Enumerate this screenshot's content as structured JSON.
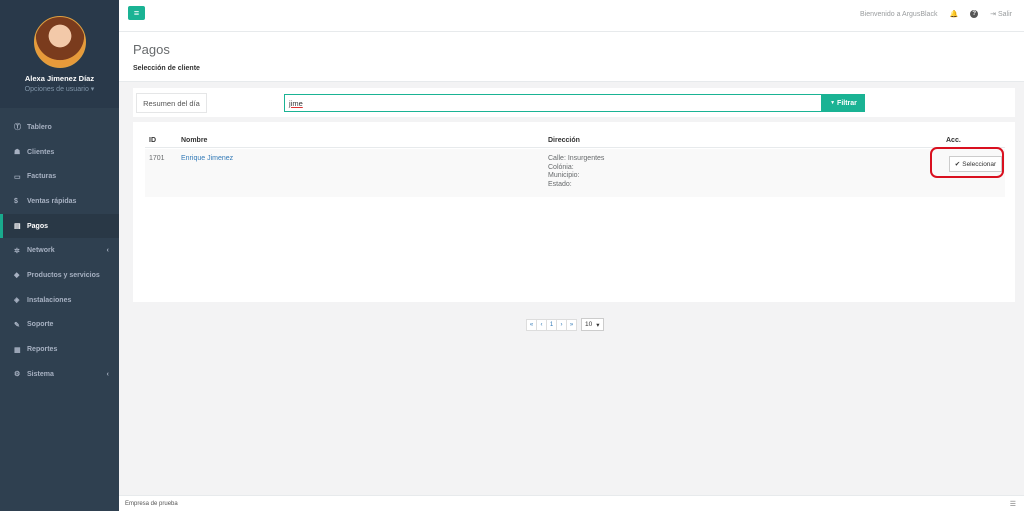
{
  "user": {
    "name": "Alexa Jimenez Díaz",
    "options": "Opciones de usuario ▾"
  },
  "nav": [
    {
      "icon": "Ⓣ",
      "label": "Tablero",
      "icon_name": "dashboard-icon"
    },
    {
      "icon": "☗",
      "label": "Clientes",
      "icon_name": "users-icon"
    },
    {
      "icon": "▭",
      "label": "Facturas",
      "icon_name": "file-icon"
    },
    {
      "icon": "$",
      "label": "Ventas rápidas",
      "icon_name": "dollar-icon"
    },
    {
      "icon": "▤",
      "label": "Pagos",
      "icon_name": "money-icon"
    },
    {
      "icon": "✲",
      "label": "Network",
      "icon_name": "network-icon"
    },
    {
      "icon": "◆",
      "label": "Productos y servicios",
      "icon_name": "tag-icon"
    },
    {
      "icon": "◈",
      "label": "Instalaciones",
      "icon_name": "rocket-icon"
    },
    {
      "icon": "✎",
      "label": "Soporte",
      "icon_name": "wrench-icon"
    },
    {
      "icon": "▦",
      "label": "Reportes",
      "icon_name": "book-icon"
    },
    {
      "icon": "⚙",
      "label": "Sistema",
      "icon_name": "cogs-icon"
    }
  ],
  "topbar": {
    "menu": "≡",
    "welcome": "Bienvenido a ArgusBlack",
    "bell": "🔔",
    "help": "?",
    "logout_icon": "⇥",
    "logout": "Salir"
  },
  "page": {
    "title": "Pagos",
    "subtitle": "Selección de cliente"
  },
  "filters": {
    "summary_button": "Resumen del día",
    "search_value": "jime",
    "filter_button": "Filtrar",
    "filter_icon": "▼"
  },
  "table": {
    "headers": {
      "id": "ID",
      "name": "Nombre",
      "address": "Dirección",
      "actions": "Acc."
    },
    "rows": [
      {
        "id": "1701",
        "name": "Enrique Jimenez",
        "address": [
          "Calle: Insurgentes",
          "Colónia:",
          "Municipio:",
          "Estado:"
        ],
        "action_icon": "✔",
        "action": "Seleccionar"
      }
    ]
  },
  "pagination": {
    "first": "«",
    "prev": "‹",
    "page": "1",
    "next": "›",
    "last": "»",
    "page_size": "10",
    "page_size_caret": "▾"
  },
  "footer": {
    "text": "Empresa de prueba",
    "icon": "☰"
  },
  "colors": {
    "accent": "#1ab394",
    "sidebar": "#2f4050",
    "highlight": "#d9101f"
  }
}
